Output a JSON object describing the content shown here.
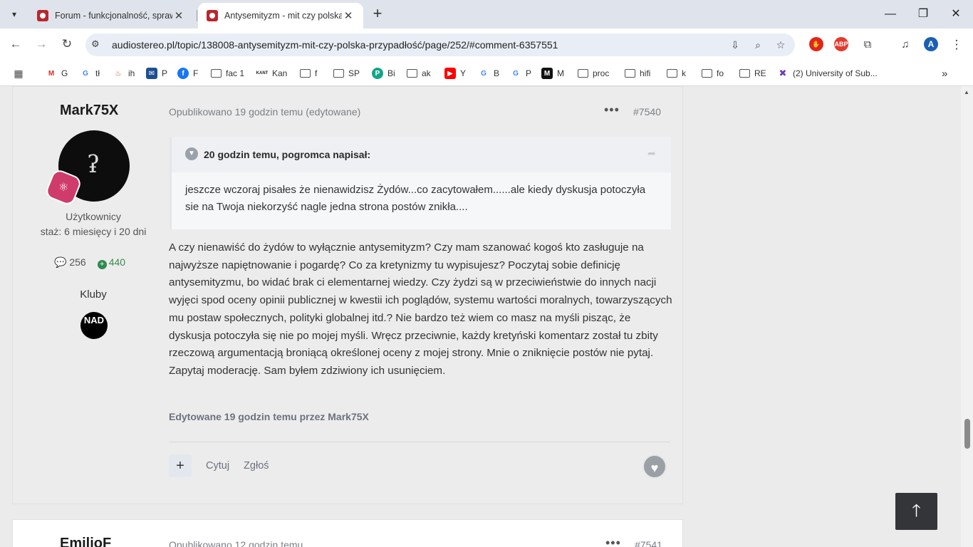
{
  "browser": {
    "tabs": [
      {
        "title": "Forum - funkcjonalność, sprawy"
      },
      {
        "title": "Antysemityzm - mit czy polska p"
      }
    ],
    "url": "audiostereo.pl/topic/138008-antysemityzm-mit-czy-polska-przypadłość/page/252/#comment-6357551",
    "extensions": {
      "abp": "ABP"
    },
    "profile_initial": "A",
    "bookmarks": [
      {
        "label": "G",
        "icon": "gmail-icon"
      },
      {
        "label": "tł",
        "icon": "google-icon"
      },
      {
        "label": "ih",
        "icon": "flame-icon"
      },
      {
        "label": "P",
        "icon": "mail-icon"
      },
      {
        "label": "F",
        "icon": "facebook-icon"
      },
      {
        "label": "fac 1",
        "icon": "folder-icon"
      },
      {
        "label": "Kan",
        "icon": "kantor-icon"
      },
      {
        "label": "f",
        "icon": "folder-icon"
      },
      {
        "label": "SP",
        "icon": "folder-icon"
      },
      {
        "label": "Bi",
        "icon": "circle-icon"
      },
      {
        "label": "ak",
        "icon": "folder-icon"
      },
      {
        "label": "Y",
        "icon": "youtube-icon"
      },
      {
        "label": "B",
        "icon": "google-icon"
      },
      {
        "label": "P",
        "icon": "google-icon"
      },
      {
        "label": "M",
        "icon": "m-logo-icon"
      },
      {
        "label": "proc",
        "icon": "folder-icon"
      },
      {
        "label": "hifi",
        "icon": "folder-icon"
      },
      {
        "label": "k",
        "icon": "folder-icon"
      },
      {
        "label": "fo",
        "icon": "folder-icon"
      },
      {
        "label": "RE",
        "icon": "folder-icon"
      },
      {
        "label": "(2) University of Sub...",
        "icon": "x-logo-icon"
      }
    ]
  },
  "post": {
    "author": "Mark75X",
    "rank": "Użytkownicy",
    "tenure": "staż: 6 miesięcy i 20 dni",
    "posts_count": "256",
    "reputation": "440",
    "clubs_label": "Kluby",
    "club_logo_text": "NAD",
    "published": "Opublikowano 19 godzin temu (edytowane)",
    "number": "#7540",
    "quote_author": "20 godzin temu, pogromca napisał:",
    "quote_text": "jeszcze wczoraj pisałes że nienawidzisz Żydów...co zacytowałem......ale kiedy dyskusja potoczyła sie na Twoja niekorzyść nagle jedna strona postów znikła....",
    "content": "A czy nienawiść do żydów to wyłącznie antysemityzm? Czy mam szanować kogoś kto zasługuje na najwyższe napiętnowanie i pogardę? Co za kretynizmy tu wypisujesz? Poczytaj sobie definicję antysemityzmu, bo widać brak ci elementarnej wiedzy. Czy żydzi są w przeciwieństwie do innych nacji wyjęci spod oceny opinii publicznej w kwestii ich poglądów, systemu wartości moralnych, towarzyszących mu postaw społecznych, polityki globalnej itd.? Nie bardzo też wiem co masz na myśli pisząc, że dyskusja potoczyła się nie po mojej myśli. Wręcz przeciwnie, każdy kretyński komentarz został tu zbity rzeczową argumentacją broniącą określonej oceny z mojej strony. Mnie o zniknięcie postów nie pytaj. Zapytaj moderację. Sam byłem zdziwiony ich usunięciem.",
    "edited_note": "Edytowane 19 godzin temu przez Mark75X",
    "actions": {
      "quote": "Cytuj",
      "report": "Zgłoś"
    }
  },
  "next_post": {
    "author": "EmilioF",
    "published": "Opublikowano 12 godzin temu",
    "number": "#7541"
  },
  "colors": {
    "favicon": "#b8282f",
    "badge": "#cf3b6b",
    "reputation": "#2f8a4e"
  }
}
